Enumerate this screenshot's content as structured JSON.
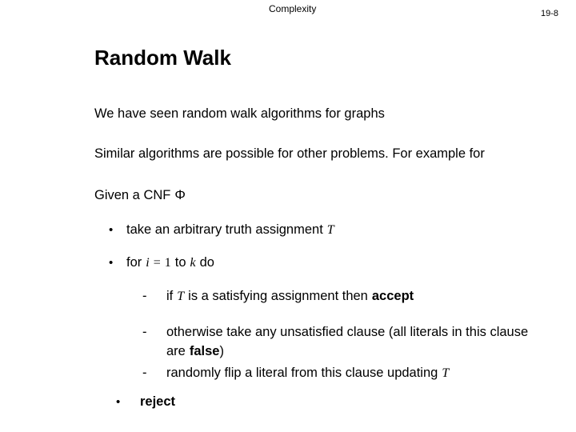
{
  "header": {
    "course_title": "Complexity",
    "page_number": "19-8"
  },
  "slide": {
    "title": "Random Walk",
    "paragraphs": [
      "We have seen random walk algorithms for graphs",
      "Similar algorithms are possible for other problems.  For example for",
      "Given a  CNF"
    ],
    "cnf_symbol": "Φ",
    "bullets": {
      "bullet_marker": "•",
      "dash_marker": "-",
      "take_assignment": {
        "text": "take an arbitrary truth assignment",
        "variable": "T"
      },
      "for_loop": {
        "keyword_for": "for",
        "index_var": "i",
        "equals": "=",
        "start": "1",
        "keyword_to": "to",
        "bound_var": "k",
        "keyword_do": "do"
      },
      "if_accept": {
        "keyword_if": "if",
        "variable": "T",
        "text": "is a satisfying assignment  then",
        "action": "accept"
      },
      "otherwise": {
        "line1": "otherwise take any unsatisfied clause (all literals in this clause",
        "line2_prefix": "are",
        "line2_bold": "false",
        "line2_suffix": ")"
      },
      "flip_literal": {
        "text": "randomly flip a literal from this clause updating",
        "variable": "T"
      },
      "reject_action": "reject"
    }
  }
}
